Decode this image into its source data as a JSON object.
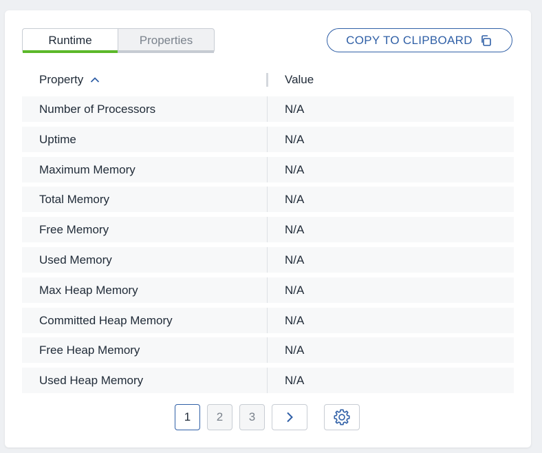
{
  "tabs": {
    "runtime": "Runtime",
    "properties": "Properties"
  },
  "copy_button": {
    "label": "COPY TO CLIPBOARD",
    "icon": "copy-icon"
  },
  "table": {
    "headers": {
      "property": "Property",
      "value": "Value",
      "sort": "ascending"
    },
    "rows": [
      {
        "property": "Number of Processors",
        "value": "N/A"
      },
      {
        "property": "Uptime",
        "value": "N/A"
      },
      {
        "property": "Maximum Memory",
        "value": "N/A"
      },
      {
        "property": "Total Memory",
        "value": "N/A"
      },
      {
        "property": "Free Memory",
        "value": "N/A"
      },
      {
        "property": "Used Memory",
        "value": "N/A"
      },
      {
        "property": "Max Heap Memory",
        "value": "N/A"
      },
      {
        "property": "Committed Heap Memory",
        "value": "N/A"
      },
      {
        "property": "Free Heap Memory",
        "value": "N/A"
      },
      {
        "property": "Used Heap Memory",
        "value": "N/A"
      }
    ]
  },
  "pagination": {
    "pages": [
      "1",
      "2",
      "3"
    ],
    "current": "1",
    "next_icon": "chevron-right-icon",
    "settings_icon": "gear-icon"
  },
  "colors": {
    "accent": "#2f5fa6",
    "active_tab": "#5cb82a"
  }
}
